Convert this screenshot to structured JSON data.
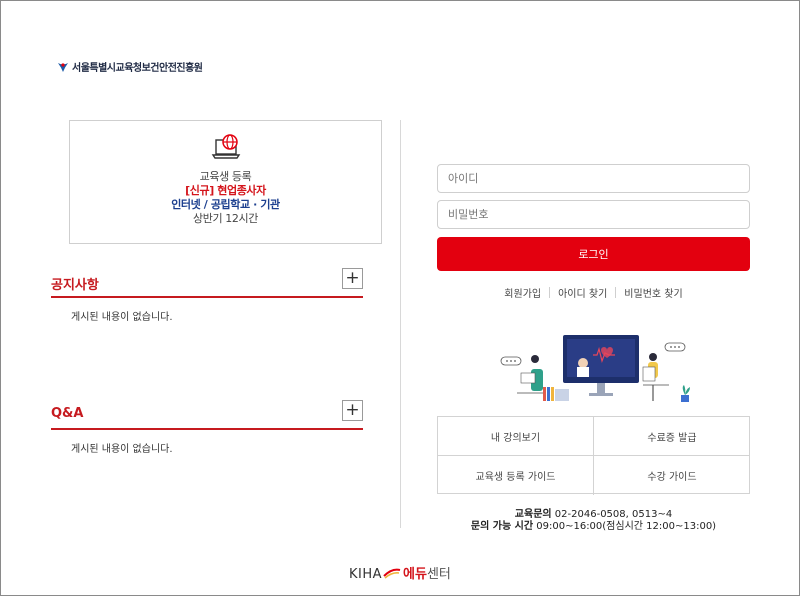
{
  "header": {
    "org_name": "서울특별시교육청보건안전진흥원"
  },
  "registration": {
    "line1": "교육생 등록",
    "line2": "[신규] 현업종사자",
    "line3": "인터넷 / 공립학교 · 기관",
    "line4": "상반기 12시간",
    "icon": "laptop-globe-icon"
  },
  "notice": {
    "title": "공지사항",
    "plus_label": "+",
    "empty_text": "게시된 내용이 없습니다."
  },
  "qna": {
    "title": "Q&A",
    "plus_label": "+",
    "empty_text": "게시된 내용이 없습니다."
  },
  "login": {
    "id_placeholder": "아이디",
    "pw_placeholder": "비밀번호",
    "button_label": "로그인"
  },
  "account_links": {
    "signup": "회원가입",
    "find_id": "아이디 찾기",
    "find_pw": "비밀번호 찾기"
  },
  "quick_menu": {
    "my_courses": "내 강의보기",
    "certificate": "수료증 발급",
    "register_guide": "교육생 등록 가이드",
    "course_guide": "수강 가이드"
  },
  "contact": {
    "label1": "교육문의",
    "phone": "02-2046-0508, 0513~4",
    "label2": "문의 가능 시간",
    "hours": "09:00~16:00(점심시간 12:00~13:00)"
  },
  "footer": {
    "brand": "KIHA",
    "edu": "에듀",
    "center": "센터"
  },
  "colors": {
    "accent": "#e3000f",
    "title_red": "#c61a1f",
    "navy": "#1c3f8f"
  }
}
